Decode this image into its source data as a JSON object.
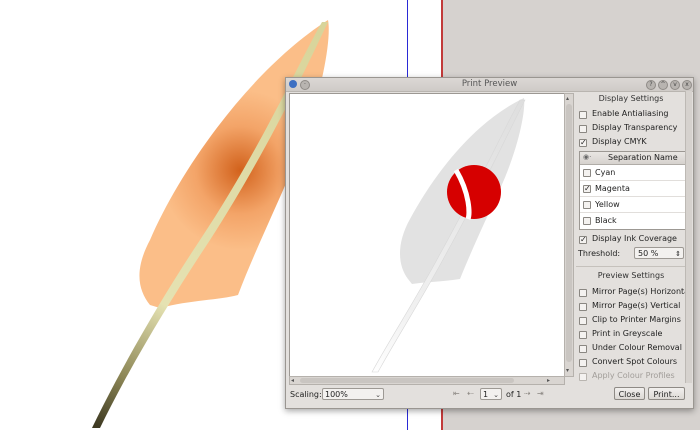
{
  "window": {
    "title": "Print Preview"
  },
  "bottom_bar": {
    "scaling_label": "Scaling:",
    "scaling_value": "100%",
    "page_value": "1",
    "page_of": "of 1",
    "close_label": "Close",
    "print_label": "Print..."
  },
  "display_settings": {
    "heading": "Display Settings",
    "options": [
      {
        "label": "Enable Antialiasing",
        "checked": false
      },
      {
        "label": "Display Transparency",
        "checked": false
      },
      {
        "label": "Display CMYK",
        "checked": true
      }
    ],
    "separation_header": "Separation Name",
    "separations": [
      {
        "label": "Cyan",
        "checked": false
      },
      {
        "label": "Magenta",
        "checked": true
      },
      {
        "label": "Yellow",
        "checked": false
      },
      {
        "label": "Black",
        "checked": false
      }
    ],
    "ink_coverage_label": "Display Ink Coverage",
    "ink_coverage_checked": true,
    "threshold_label": "Threshold:",
    "threshold_value": "50 %"
  },
  "preview_settings": {
    "heading": "Preview Settings",
    "options": [
      {
        "label": "Mirror Page(s) Horizontal",
        "checked": false,
        "enabled": true
      },
      {
        "label": "Mirror Page(s) Vertical",
        "checked": false,
        "enabled": true
      },
      {
        "label": "Clip to Printer Margins",
        "checked": false,
        "enabled": true
      },
      {
        "label": "Print in Greyscale",
        "checked": false,
        "enabled": true
      },
      {
        "label": "Under Colour Removal",
        "checked": false,
        "enabled": true
      },
      {
        "label": "Convert Spot Colours",
        "checked": false,
        "enabled": true
      },
      {
        "label": "Apply Colour Profiles",
        "checked": false,
        "enabled": false
      }
    ]
  },
  "colors": {
    "feather_fill": "#fbbe88",
    "feather_spot": "#d2621c",
    "quill": "#d8d49a",
    "magenta_preview": "#d60000",
    "blue_guide": "#2a2ad6",
    "red_guide": "#c23a3a"
  },
  "icons": {
    "app": "app-icon",
    "help": "help-icon",
    "shade": "shade-icon",
    "minimize": "minimize-icon",
    "close": "close-icon"
  }
}
